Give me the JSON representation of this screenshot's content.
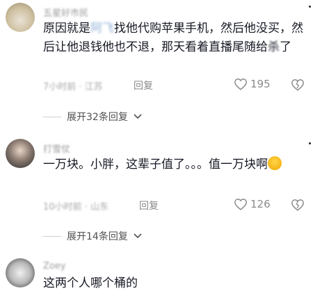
{
  "comments": [
    {
      "username": "五星好市民",
      "text_pre": "原因就是",
      "text_blurred": "阿飞",
      "text_post": "找他代购苹果手机，然后他没买，然后让他退钱他也不退，那天看着直播尾随给",
      "text_blurred2": "杀",
      "text_end": "了",
      "time": "7小时前 · 江苏",
      "reply_label": "回复",
      "likes": "195",
      "expand_label": "展开32条回复"
    },
    {
      "username": "打雪仗",
      "text": "一万块。小胖，这辈子值了。。。值一万块啊",
      "time": "10小时前 · 山东",
      "reply_label": "回复",
      "likes": "126",
      "expand_label": "展开14条回复"
    },
    {
      "username": "Zoey",
      "text": "这两个人哪个桶的"
    }
  ]
}
